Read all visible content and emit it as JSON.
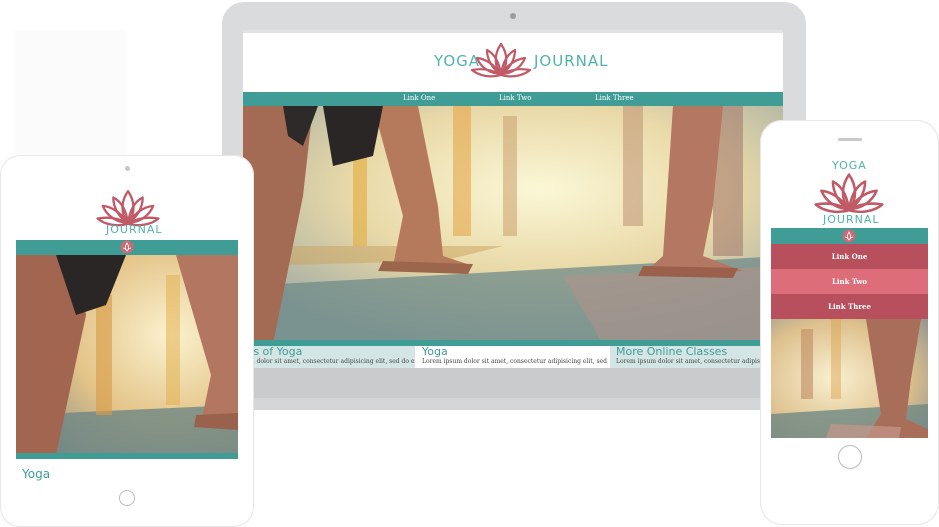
{
  "brand": {
    "word1": "YOGA",
    "word2": "JOURNAL",
    "accent": "#3f9d96",
    "lotus_color": "#c05a66"
  },
  "nav": {
    "links": [
      "Link One",
      "Link Two",
      "Link Three"
    ],
    "menu_colors": [
      "#b84f5d",
      "#dd6d78",
      "#b84f5d"
    ]
  },
  "cards": [
    {
      "title": "ts of Yoga",
      "body": "m dolor sit amet, consectetur adipisicing elit, sed do eiusmod"
    },
    {
      "title": "Yoga",
      "body": "Lorem ipsum dolor sit amet, consectetur adipisicing elit, sed do eiusmod"
    },
    {
      "title": "More Online Classes",
      "body": "Lorem ipsum dolor sit amet, consectetur adipisicing elit, s"
    }
  ],
  "tablet": {
    "section_title": "Yoga"
  },
  "icons": {
    "lotus": "lotus-icon",
    "menu_toggle": "flower-toggle-icon"
  }
}
